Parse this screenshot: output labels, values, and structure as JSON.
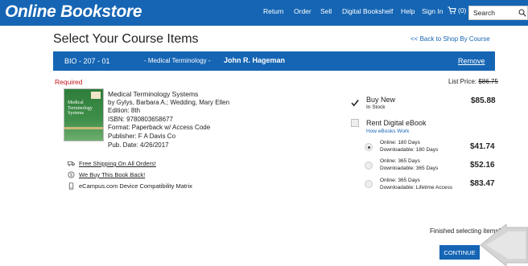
{
  "header": {
    "logo": "Online Bookstore",
    "nav": {
      "return": "Return",
      "order": "Order",
      "sell": "Sell",
      "digital_bookshelf": "Digital Bookshelf",
      "help": "Help",
      "sign_in": "Sign In"
    },
    "cart_count": "(0)",
    "search_placeholder": "Search",
    "brand_color": "#1565b4"
  },
  "page": {
    "title": "Select Your Course Items",
    "back_link": "<< Back to Shop By Course"
  },
  "course": {
    "code": "BIO - 207 - 01",
    "name": "- Medical Terminology -",
    "instructor": "John R. Hageman",
    "remove": "Remove"
  },
  "book": {
    "required": "Required",
    "list_price_label": "List Price:",
    "list_price": "$86.75",
    "cover_text": [
      "Medical",
      "Terminology",
      "Systems"
    ],
    "title": "Medical Terminology Systems",
    "authors": "by Gylys, Barbara A.; Wedding, Mary Ellen",
    "edition": "Edition: 8th",
    "isbn": "ISBN: 9780803658677",
    "format": "Format: Paperback w/ Access Code",
    "publisher": "Publisher: F A Davis Co",
    "pub_date": "Pub. Date: 4/26/2017"
  },
  "perks": {
    "free_shipping": "Free Shipping On All Orders!",
    "buy_back": "We Buy This Book Back!",
    "compatibility": "eCampus.com Device Compatibility Matrix"
  },
  "options": {
    "buy_new": {
      "label": "Buy New",
      "status": "In Stock",
      "price": "$85.88",
      "checked": true
    },
    "rent": {
      "label": "Rent Digital eBook",
      "link": "How eBooks Work",
      "checked": false,
      "choices": [
        {
          "line1": "Online: 180 Days",
          "line2": "Downloadable: 180 Days",
          "price": "$41.74",
          "selected": true
        },
        {
          "line1": "Online: 365 Days",
          "line2": "Downloadable: 365 Days",
          "price": "$52.16",
          "selected": false
        },
        {
          "line1": "Online: 365 Days",
          "line2": "Downloadable: Lifetime Access",
          "price": "$83.47",
          "selected": false
        }
      ]
    }
  },
  "footer": {
    "finished": "Finished selecting items?",
    "continue": "CONTINUE"
  }
}
